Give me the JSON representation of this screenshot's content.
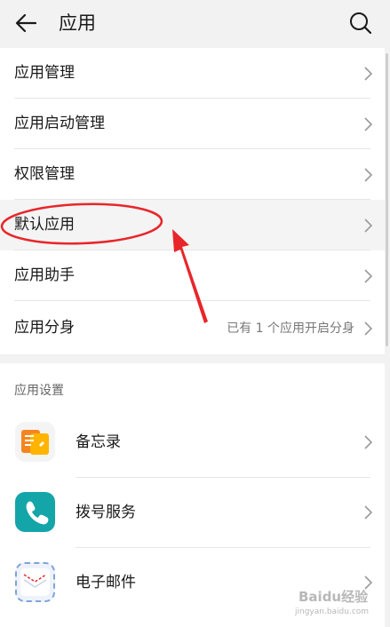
{
  "header": {
    "title": "应用"
  },
  "menu": {
    "items": [
      {
        "label": "应用管理"
      },
      {
        "label": "应用启动管理"
      },
      {
        "label": "权限管理"
      },
      {
        "label": "默认应用"
      },
      {
        "label": "应用助手"
      },
      {
        "label": "应用分身",
        "sub": "已有 1 个应用开启分身"
      }
    ]
  },
  "settings": {
    "section_title": "应用设置",
    "apps": [
      {
        "label": "备忘录",
        "icon": "memo-icon"
      },
      {
        "label": "拨号服务",
        "icon": "phone-icon"
      },
      {
        "label": "电子邮件",
        "icon": "mail-icon"
      }
    ]
  },
  "watermark": {
    "text": "Baidu经验",
    "url": "jingyan.baidu.com"
  },
  "colors": {
    "annotation_red": "#e8262a",
    "phone_teal": "#14a5a8",
    "memo_orange": "#f59a23"
  }
}
